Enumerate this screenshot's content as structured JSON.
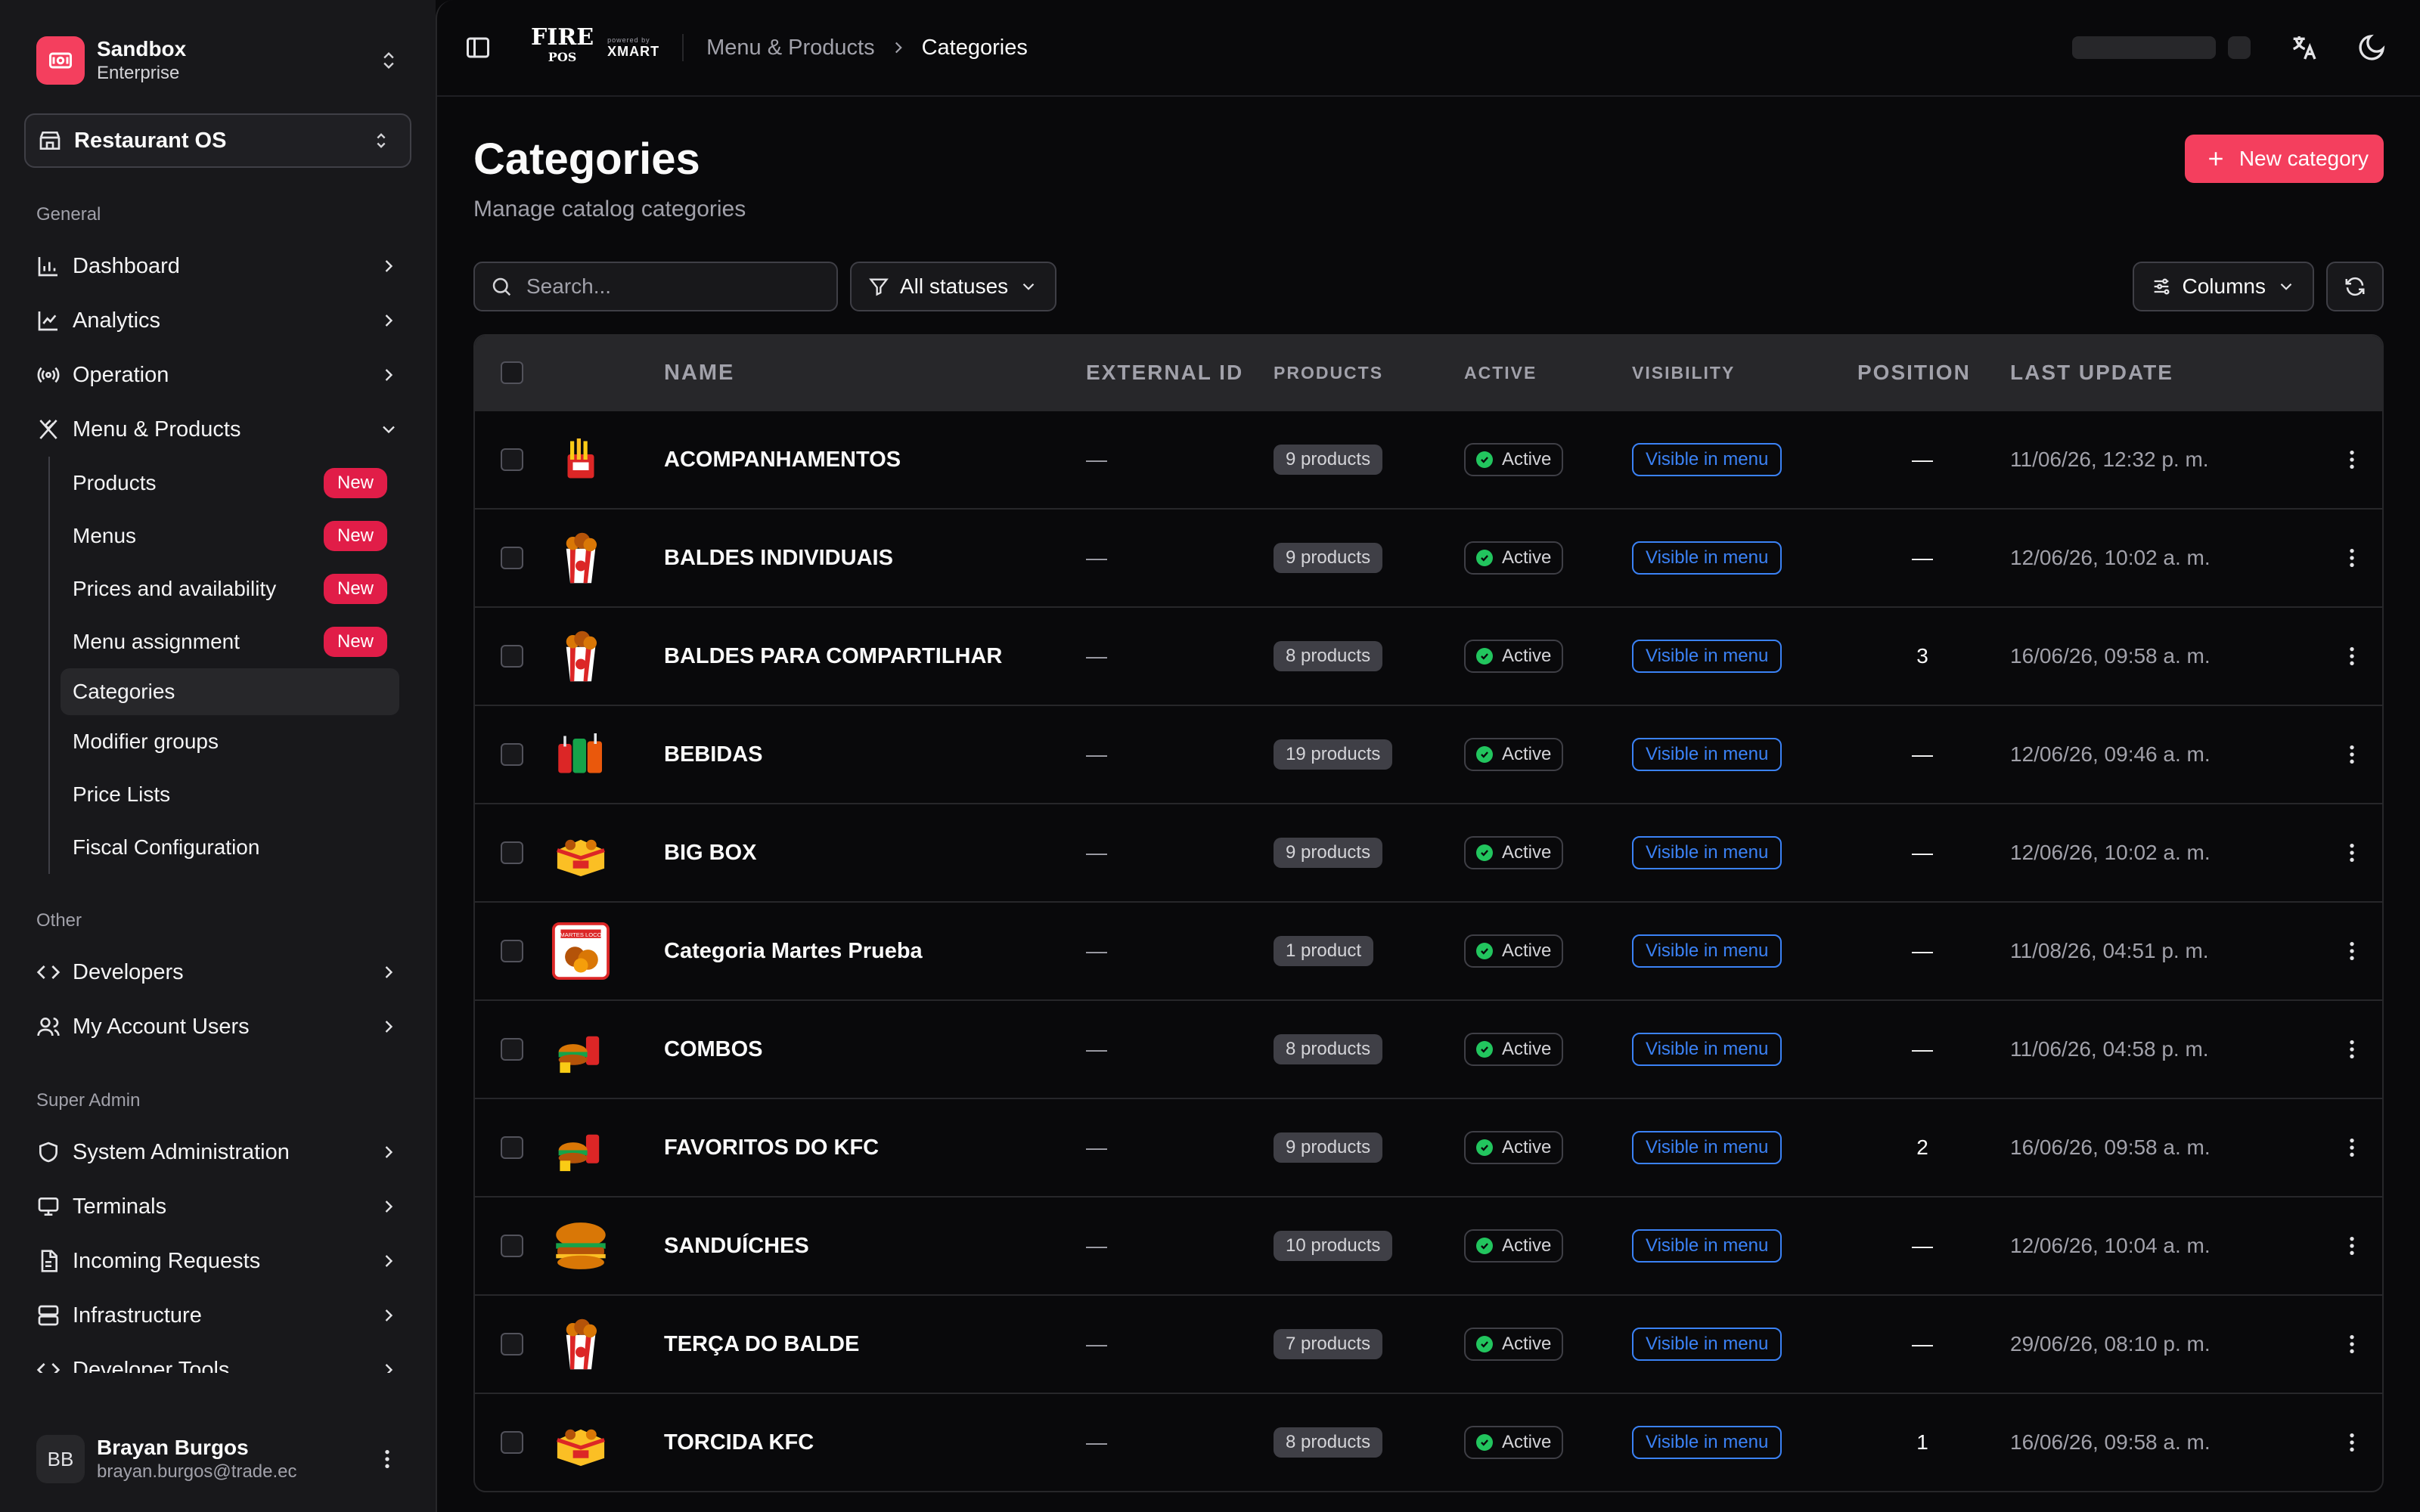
{
  "sidebar": {
    "team": {
      "name": "Sandbox",
      "plan": "Enterprise"
    },
    "org": "Restaurant OS",
    "general_label": "General",
    "general": [
      {
        "label": "Dashboard",
        "icon": "bar-chart-icon"
      },
      {
        "label": "Analytics",
        "icon": "line-chart-icon"
      },
      {
        "label": "Operation",
        "icon": "radio-icon"
      },
      {
        "label": "Menu & Products",
        "icon": "utensils-icon"
      }
    ],
    "menu_sub": [
      {
        "label": "Products",
        "badge": "New"
      },
      {
        "label": "Menus",
        "badge": "New"
      },
      {
        "label": "Prices and availability",
        "badge": "New"
      },
      {
        "label": "Menu assignment",
        "badge": "New"
      },
      {
        "label": "Categories"
      },
      {
        "label": "Modifier groups"
      },
      {
        "label": "Price Lists"
      },
      {
        "label": "Fiscal Configuration"
      }
    ],
    "other_label": "Other",
    "other": [
      {
        "label": "Developers",
        "icon": "code-icon"
      },
      {
        "label": "My Account Users",
        "icon": "users-icon"
      }
    ],
    "super_label": "Super Admin",
    "super": [
      {
        "label": "System Administration",
        "icon": "shield-icon"
      },
      {
        "label": "Terminals",
        "icon": "terminal-icon"
      },
      {
        "label": "Incoming Requests",
        "icon": "file-icon"
      },
      {
        "label": "Infrastructure",
        "icon": "server-icon"
      },
      {
        "label": "Developer Tools",
        "icon": "code-icon"
      }
    ],
    "user": {
      "initials": "BB",
      "name": "Brayan Burgos",
      "email": "brayan.burgos@trade.ec"
    }
  },
  "topbar": {
    "brand_fire": "FIRE",
    "brand_pos": "POS",
    "brand_powered": "powered by",
    "brand_xmart": "XMART",
    "breadcrumb": [
      "Menu & Products",
      "Categories"
    ]
  },
  "page": {
    "title": "Categories",
    "subtitle": "Manage catalog categories",
    "new_button": "New category",
    "search_placeholder": "Search...",
    "status_filter": "All statuses",
    "columns_button": "Columns"
  },
  "table": {
    "headers": [
      "NAME",
      "EXTERNAL ID",
      "PRODUCTS",
      "ACTIVE",
      "VISIBILITY",
      "POSITION",
      "LAST UPDATE"
    ],
    "rows": [
      {
        "name": "ACOMPANHAMENTOS",
        "ext": "—",
        "products": "9 products",
        "active": "Active",
        "visibility": "Visible in menu",
        "position": "—",
        "updated": "11/06/26, 12:32 p. m.",
        "thumb": "fries"
      },
      {
        "name": "BALDES INDIVIDUAIS",
        "ext": "—",
        "products": "9 products",
        "active": "Active",
        "visibility": "Visible in menu",
        "position": "—",
        "updated": "12/06/26, 10:02 a. m.",
        "thumb": "bucket"
      },
      {
        "name": "BALDES PARA COMPARTILHAR",
        "ext": "—",
        "products": "8 products",
        "active": "Active",
        "visibility": "Visible in menu",
        "position": "3",
        "updated": "16/06/26, 09:58 a. m.",
        "thumb": "bucket"
      },
      {
        "name": "BEBIDAS",
        "ext": "—",
        "products": "19 products",
        "active": "Active",
        "visibility": "Visible in menu",
        "position": "—",
        "updated": "12/06/26, 09:46 a. m.",
        "thumb": "drinks"
      },
      {
        "name": "BIG BOX",
        "ext": "—",
        "products": "9 products",
        "active": "Active",
        "visibility": "Visible in menu",
        "position": "—",
        "updated": "12/06/26, 10:02 a. m.",
        "thumb": "box"
      },
      {
        "name": "Categoria Martes Prueba",
        "ext": "—",
        "products": "1 product",
        "active": "Active",
        "visibility": "Visible in menu",
        "position": "—",
        "updated": "11/08/26, 04:51 p. m.",
        "thumb": "promo"
      },
      {
        "name": "COMBOS",
        "ext": "—",
        "products": "8 products",
        "active": "Active",
        "visibility": "Visible in menu",
        "position": "—",
        "updated": "11/06/26, 04:58 p. m.",
        "thumb": "combo"
      },
      {
        "name": "FAVORITOS DO KFC",
        "ext": "—",
        "products": "9 products",
        "active": "Active",
        "visibility": "Visible in menu",
        "position": "2",
        "updated": "16/06/26, 09:58 a. m.",
        "thumb": "combo"
      },
      {
        "name": "SANDUÍCHES",
        "ext": "—",
        "products": "10 products",
        "active": "Active",
        "visibility": "Visible in menu",
        "position": "—",
        "updated": "12/06/26, 10:04 a. m.",
        "thumb": "burger"
      },
      {
        "name": "TERÇA DO BALDE",
        "ext": "—",
        "products": "7 products",
        "active": "Active",
        "visibility": "Visible in menu",
        "position": "—",
        "updated": "29/06/26, 08:10 p. m.",
        "thumb": "bucket"
      },
      {
        "name": "TORCIDA KFC",
        "ext": "—",
        "products": "8 products",
        "active": "Active",
        "visibility": "Visible in menu",
        "position": "1",
        "updated": "16/06/26, 09:58 a. m.",
        "thumb": "box"
      }
    ]
  },
  "colors": {
    "accent": "#f43f5e",
    "badge": "#e11d48",
    "link": "#3b82f6",
    "success": "#22c55e"
  }
}
